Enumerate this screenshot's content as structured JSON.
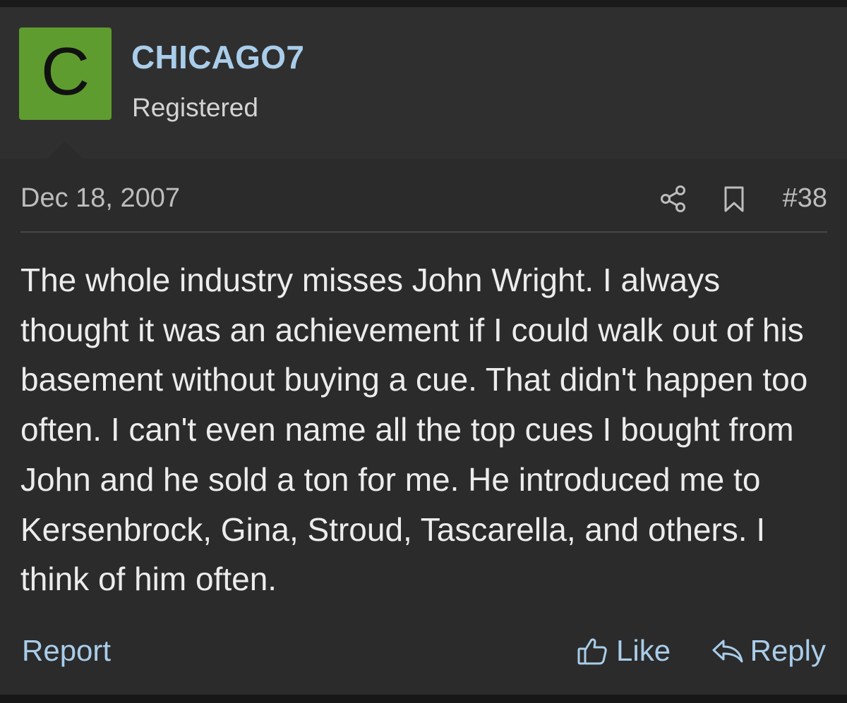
{
  "user": {
    "avatar_letter": "C",
    "avatar_color": "#5f9c2f",
    "username": "CHICAGO7",
    "username_color": "#a9cdea",
    "title": "Registered"
  },
  "post": {
    "date": "Dec 18, 2007",
    "number": "#38",
    "icons": [
      "share-icon",
      "bookmark-icon"
    ],
    "body": "The whole industry misses John Wright. I always thought it was an achievement if I could walk out of his basement without buying a cue. That didn't happen too often. I can't even name all the top cues I bought from John and he sold a ton for me. He introduced me to Kersenbrock, Gina, Stroud, Tascarella, and others. I think of him often."
  },
  "actions": {
    "report_label": "Report",
    "like_label": "Like",
    "reply_label": "Reply",
    "link_color": "#a9cdea"
  }
}
